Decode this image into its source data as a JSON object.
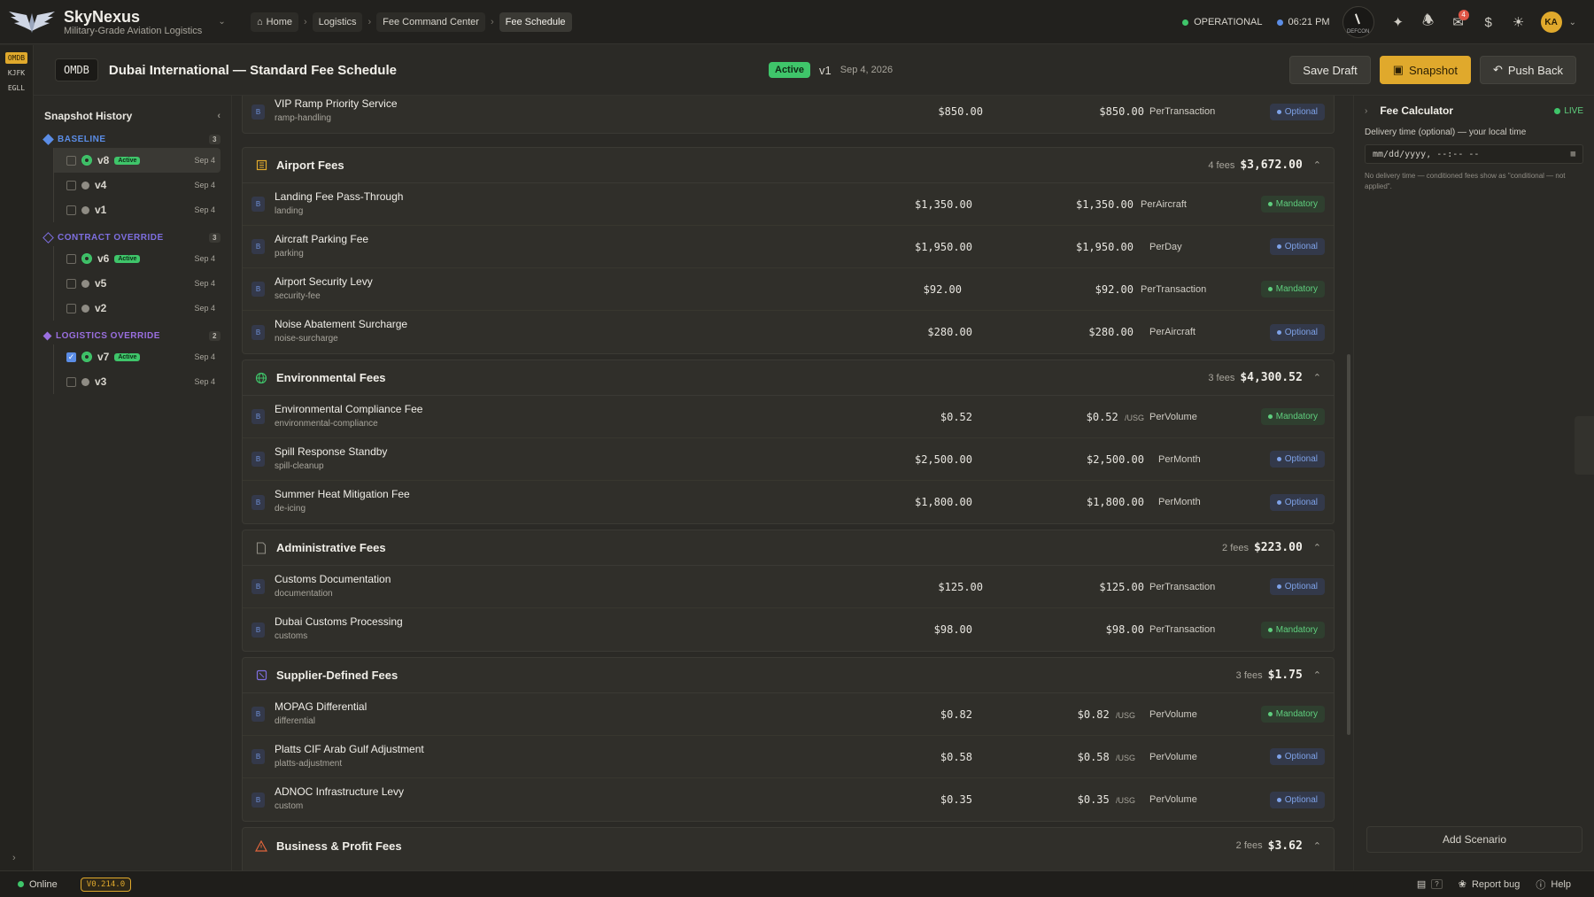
{
  "brand": {
    "title": "SkyNexus",
    "subtitle": "Military-Grade Aviation Logistics"
  },
  "breadcrumb": [
    "Home",
    "Logistics",
    "Fee Command Center",
    "Fee Schedule"
  ],
  "topbar": {
    "status": "OPERATIONAL",
    "time": "06:21 PM",
    "gauge_label": "DEFCON",
    "notification_count": "4",
    "avatar": "KA"
  },
  "rail": [
    "OMDB",
    "KJFK",
    "EGLL"
  ],
  "header": {
    "code": "OMDB",
    "title": "Dubai International — Standard Fee Schedule",
    "status": "Active",
    "version": "v1",
    "date": "Sep 4, 2026",
    "buttons": {
      "save_draft": "Save Draft",
      "snapshot": "Snapshot",
      "push_back": "Push Back"
    }
  },
  "snapshot_history": {
    "title": "Snapshot History",
    "groups": [
      {
        "name": "BASELINE",
        "count": "3",
        "color": "#5b8de6",
        "items": [
          {
            "v": "v8",
            "active": "Active",
            "date": "Sep 4"
          },
          {
            "v": "v4",
            "date": "Sep 4"
          },
          {
            "v": "v1",
            "date": "Sep 4"
          }
        ]
      },
      {
        "name": "CONTRACT OVERRIDE",
        "count": "3",
        "color": "#7e6fe0",
        "items": [
          {
            "v": "v6",
            "active": "Active",
            "date": "Sep 4"
          },
          {
            "v": "v5",
            "date": "Sep 4"
          },
          {
            "v": "v2",
            "date": "Sep 4"
          }
        ]
      },
      {
        "name": "LOGISTICS OVERRIDE",
        "count": "2",
        "color": "#9a6fe0",
        "items": [
          {
            "v": "v7",
            "active": "Active",
            "date": "Sep 4"
          },
          {
            "v": "v3",
            "date": "Sep 4"
          }
        ]
      }
    ]
  },
  "sections": {
    "ramp": {
      "rows": [
        {
          "name": "VIP Ramp Priority Service",
          "code": "ramp-handling",
          "base": "$850.00",
          "amount": "$850.00",
          "unit": "",
          "basis": "PerTransaction",
          "tag": "Optional"
        }
      ]
    },
    "airport": {
      "title": "Airport Fees",
      "count": "4 fees",
      "total": "$3,672.00",
      "rows": [
        {
          "name": "Landing Fee Pass-Through",
          "code": "landing",
          "base": "$1,350.00",
          "amount": "$1,350.00",
          "unit": "",
          "basis": "PerAircraft",
          "tag": "Mandatory"
        },
        {
          "name": "Aircraft Parking Fee",
          "code": "parking",
          "base": "$1,950.00",
          "amount": "$1,950.00",
          "unit": "",
          "basis": "PerDay",
          "tag": "Optional"
        },
        {
          "name": "Airport Security Levy",
          "code": "security-fee",
          "base": "$92.00",
          "amount": "$92.00",
          "unit": "",
          "basis": "PerTransaction",
          "tag": "Mandatory"
        },
        {
          "name": "Noise Abatement Surcharge",
          "code": "noise-surcharge",
          "base": "$280.00",
          "amount": "$280.00",
          "unit": "",
          "basis": "PerAircraft",
          "tag": "Optional"
        }
      ]
    },
    "environmental": {
      "title": "Environmental Fees",
      "count": "3 fees",
      "total": "$4,300.52",
      "rows": [
        {
          "name": "Environmental Compliance Fee",
          "code": "environmental-compliance",
          "base": "$0.52",
          "amount": "$0.52",
          "unit": "/USG",
          "basis": "PerVolume",
          "tag": "Mandatory"
        },
        {
          "name": "Spill Response Standby",
          "code": "spill-cleanup",
          "base": "$2,500.00",
          "amount": "$2,500.00",
          "unit": "",
          "basis": "PerMonth",
          "tag": "Optional"
        },
        {
          "name": "Summer Heat Mitigation Fee",
          "code": "de-icing",
          "base": "$1,800.00",
          "amount": "$1,800.00",
          "unit": "",
          "basis": "PerMonth",
          "tag": "Optional"
        }
      ]
    },
    "administrative": {
      "title": "Administrative Fees",
      "count": "2 fees",
      "total": "$223.00",
      "rows": [
        {
          "name": "Customs Documentation",
          "code": "documentation",
          "base": "$125.00",
          "amount": "$125.00",
          "unit": "",
          "basis": "PerTransaction",
          "tag": "Optional"
        },
        {
          "name": "Dubai Customs Processing",
          "code": "customs",
          "base": "$98.00",
          "amount": "$98.00",
          "unit": "",
          "basis": "PerTransaction",
          "tag": "Mandatory"
        }
      ]
    },
    "supplier": {
      "title": "Supplier-Defined Fees",
      "count": "3 fees",
      "total": "$1.75",
      "rows": [
        {
          "name": "MOPAG Differential",
          "code": "differential",
          "base": "$0.82",
          "amount": "$0.82",
          "unit": "/USG",
          "basis": "PerVolume",
          "tag": "Mandatory"
        },
        {
          "name": "Platts CIF Arab Gulf Adjustment",
          "code": "platts-adjustment",
          "base": "$0.58",
          "amount": "$0.58",
          "unit": "/USG",
          "basis": "PerVolume",
          "tag": "Optional"
        },
        {
          "name": "ADNOC Infrastructure Levy",
          "code": "custom",
          "base": "$0.35",
          "amount": "$0.35",
          "unit": "/USG",
          "basis": "PerVolume",
          "tag": "Optional"
        }
      ]
    },
    "business": {
      "title": "Business & Profit Fees",
      "count": "2 fees",
      "total": "$3.62"
    }
  },
  "fee_calculator": {
    "title": "Fee Calculator",
    "live": "LIVE",
    "label": "Delivery time (optional) — your local time",
    "placeholder": "mm/dd/yyyy, --:-- --",
    "note": "No delivery time — conditioned fees show as \"conditional — not applied\".",
    "add_scenario": "Add Scenario"
  },
  "statusbar": {
    "online": "Online",
    "version": "V0.214.0",
    "key": "?",
    "report": "Report bug",
    "help": "Help"
  },
  "colors": {
    "accent": "#e0a92c",
    "success": "#3fc56a",
    "info": "#5b8de6"
  }
}
